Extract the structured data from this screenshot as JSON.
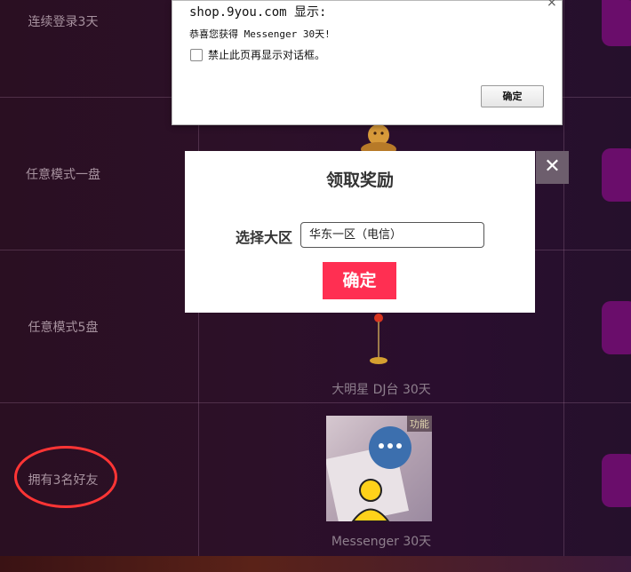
{
  "tasks": [
    {
      "label": "连续登录3天"
    },
    {
      "label": "任意模式一盘"
    },
    {
      "label": "任意模式5盘"
    },
    {
      "label": "拥有3名好友"
    }
  ],
  "rewards": [
    {
      "caption": "大明星 DJ台 30天"
    },
    {
      "caption": "Messenger 30天",
      "tag": "功能"
    }
  ],
  "alert": {
    "title": "shop.9you.com 显示:",
    "message": "恭喜您获得 Messenger 30天!",
    "checkbox_label": "禁止此页再显示对话框。",
    "ok_label": "确定",
    "close_icon": "×"
  },
  "modal": {
    "title": "领取奖励",
    "region_label": "选择大区",
    "region_value": "华东一区（电信）",
    "confirm_label": "确定",
    "close_icon": "✕"
  },
  "colors": {
    "confirm": "#ff2f52",
    "highlight_ellipse": "#ff3535",
    "action_button": "#6a0d6b"
  }
}
